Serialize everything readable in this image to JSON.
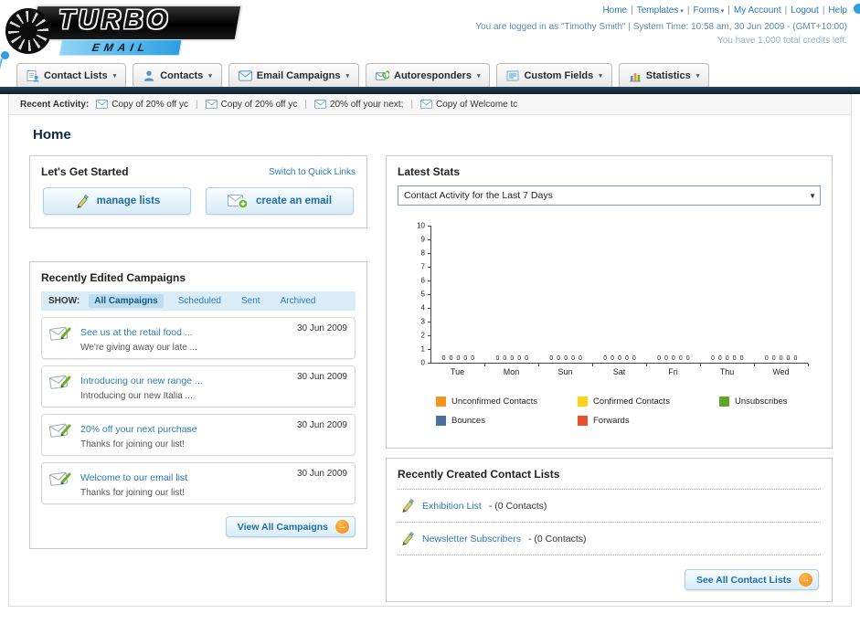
{
  "app": {
    "name": "Turbo Email",
    "logo_primary": "TURBO",
    "logo_secondary": "EMAIL"
  },
  "header": {
    "nav_links": [
      {
        "label": "Home",
        "caret": false
      },
      {
        "label": "Templates",
        "caret": true
      },
      {
        "label": "Forms",
        "caret": true
      },
      {
        "label": "My Account",
        "caret": false
      },
      {
        "label": "Logout",
        "caret": false
      },
      {
        "label": "Help",
        "caret": false
      }
    ],
    "login_line": "You are logged in as \"Timothy Smith\" | System Time: 10:58 am, 30 Jun 2009 - (GMT+10:00)",
    "credits_line": "You have 1,000 total credits left."
  },
  "nav_tabs": [
    {
      "label": "Contact Lists",
      "icon": "contact-lists-icon"
    },
    {
      "label": "Contacts",
      "icon": "contacts-icon"
    },
    {
      "label": "Email Campaigns",
      "icon": "email-campaigns-icon"
    },
    {
      "label": "Autoresponders",
      "icon": "autoresponders-icon"
    },
    {
      "label": "Custom Fields",
      "icon": "custom-fields-icon"
    },
    {
      "label": "Statistics",
      "icon": "statistics-icon"
    }
  ],
  "recent_activity": {
    "label": "Recent Activity:",
    "items": [
      "Copy of 20% off yc",
      "Copy of 20% off yc",
      "20% off your next;",
      "Copy of Welcome tc"
    ]
  },
  "page": {
    "title": "Home"
  },
  "get_started": {
    "title": "Let's Get Started",
    "switch_link": "Switch to Quick Links",
    "buttons": [
      {
        "label": "manage lists",
        "icon": "pencil-icon"
      },
      {
        "label": "create an email",
        "icon": "create-email-icon"
      }
    ]
  },
  "campaigns": {
    "title": "Recently Edited Campaigns",
    "show_label": "SHOW:",
    "filters": [
      "All Campaigns",
      "Scheduled",
      "Sent",
      "Archived"
    ],
    "active_filter": "All Campaigns",
    "items": [
      {
        "title": "See us at the retail food ...",
        "subtitle": "We're giving away our late ...",
        "date": "30 Jun 2009"
      },
      {
        "title": "Introducing our new range ...",
        "subtitle": "Introducing our new Italia ...",
        "date": "30 Jun 2009"
      },
      {
        "title": "20% off your next purchase",
        "subtitle": "Thanks for joining our list!",
        "date": "30 Jun 2009"
      },
      {
        "title": "Welcome to our email list",
        "subtitle": "Thanks for joining our list!",
        "date": "30 Jun 2009"
      }
    ],
    "view_all_label": "View All Campaigns"
  },
  "latest_stats": {
    "title": "Latest Stats",
    "selected_period": "Contact Activity for the Last 7 Days",
    "chart_data": {
      "type": "bar",
      "categories": [
        "Tue",
        "Mon",
        "Sun",
        "Sat",
        "Fri",
        "Thu",
        "Wed"
      ],
      "series": [
        {
          "name": "Unconfirmed Contacts",
          "color": "#f7941d",
          "values": [
            0,
            0,
            0,
            0,
            0,
            0,
            0
          ]
        },
        {
          "name": "Confirmed Contacts",
          "color": "#ffd11a",
          "values": [
            0,
            0,
            0,
            0,
            0,
            0,
            0
          ]
        },
        {
          "name": "Unsubscribes",
          "color": "#61a624",
          "values": [
            0,
            0,
            0,
            0,
            0,
            0,
            0
          ]
        },
        {
          "name": "Bounces",
          "color": "#4a6f9f",
          "values": [
            0,
            0,
            0,
            0,
            0,
            0,
            0
          ]
        },
        {
          "name": "Forwards",
          "color": "#e8502d",
          "values": [
            0,
            0,
            0,
            0,
            0,
            0,
            0
          ]
        }
      ],
      "ylim": [
        0,
        10
      ],
      "yticks": [
        0,
        1,
        2,
        3,
        4,
        5,
        6,
        7,
        8,
        9,
        10
      ],
      "legend_position": "bottom",
      "grid": false
    }
  },
  "contact_lists": {
    "title": "Recently Created Contact Lists",
    "items": [
      {
        "name": "Exhibition List",
        "detail": "- (0 Contacts)"
      },
      {
        "name": "Newsletter Subscribers",
        "detail": "- (0 Contacts)"
      }
    ],
    "see_all_label": "See All Contact Lists"
  }
}
